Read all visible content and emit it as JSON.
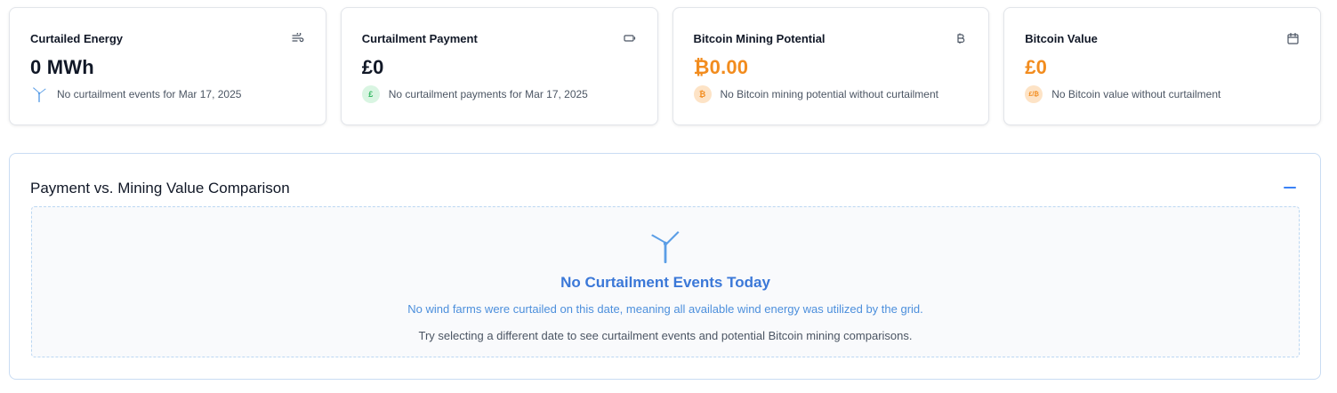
{
  "cards": [
    {
      "title": "Curtailed Energy",
      "icon": "wind-icon",
      "value": "0 MWh",
      "subtext": "No curtailment events for Mar 17, 2025",
      "badge_icon": "wind-turbine-icon"
    },
    {
      "title": "Curtailment Payment",
      "icon": "battery-icon",
      "value": "£0",
      "subtext": "No curtailment payments for Mar 17, 2025",
      "badge_icon": "pound-icon",
      "badge_glyph": "£"
    },
    {
      "title": "Bitcoin Mining Potential",
      "icon": "bitcoin-icon",
      "value": "₿0.00",
      "subtext": "No Bitcoin mining potential without curtailment",
      "badge_icon": "bitcoin-icon",
      "badge_glyph": "₿"
    },
    {
      "title": "Bitcoin Value",
      "icon": "calendar-icon",
      "value": "£0",
      "subtext": "No Bitcoin value without curtailment",
      "badge_icon": "currency-exchange-icon",
      "badge_glyph": "£/₿"
    }
  ],
  "comparison": {
    "title": "Payment vs. Mining Value Comparison",
    "collapse_icon": "minus-icon",
    "empty_state": {
      "icon": "wind-turbine-icon",
      "title": "No Curtailment Events Today",
      "message": "No wind farms were curtailed on this date, meaning all available wind energy was utilized by the grid.",
      "hint": "Try selecting a different date to see curtailment events and potential Bitcoin mining comparisons."
    }
  },
  "colors": {
    "accent_orange": "#f28c1e",
    "accent_blue": "#3b78d8",
    "badge_green": "#34b862"
  }
}
